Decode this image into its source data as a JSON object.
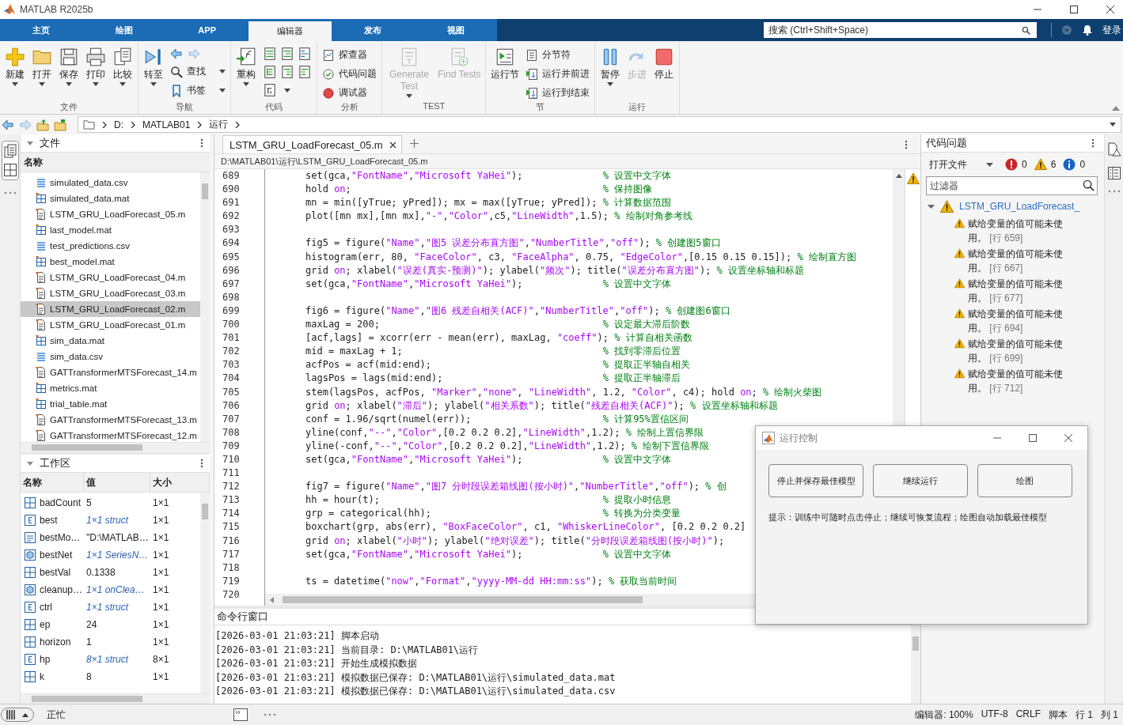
{
  "window": {
    "title": "MATLAB R2025b"
  },
  "tabs": [
    {
      "label": "主页",
      "selected": false
    },
    {
      "label": "绘图",
      "selected": false
    },
    {
      "label": "APP",
      "selected": false
    },
    {
      "label": "编辑器",
      "selected": true
    },
    {
      "label": "发布",
      "selected": false
    },
    {
      "label": "视图",
      "selected": false
    }
  ],
  "search": {
    "placeholder": "搜索 (Ctrl+Shift+Space)"
  },
  "sign_in": "登录",
  "toolstrip": {
    "groups": [
      {
        "label": "文件",
        "items": [
          {
            "kind": "large",
            "label": "新建",
            "dropdown": true,
            "disabled": false
          },
          {
            "kind": "large",
            "label": "打开",
            "dropdown": true,
            "disabled": false
          },
          {
            "kind": "large",
            "label": "保存",
            "dropdown": true,
            "disabled": false
          },
          {
            "kind": "large",
            "label": "打印",
            "dropdown": true,
            "disabled": false
          },
          {
            "kind": "large",
            "label": "比较",
            "dropdown": true,
            "disabled": false
          }
        ]
      },
      {
        "label": "导航",
        "items": [
          {
            "kind": "large",
            "label": "转至",
            "dropdown": true,
            "disabled": false
          },
          {
            "kind": "arrows"
          },
          {
            "kind": "small",
            "label": "查找",
            "dropdown": true,
            "disabled": false
          },
          {
            "kind": "small",
            "label": "书签",
            "dropdown": true,
            "disabled": false
          }
        ]
      },
      {
        "label": "代码",
        "items": [
          {
            "kind": "large",
            "label": "重构",
            "dropdown": true,
            "disabled": false
          },
          {
            "kind": "icon-grid"
          }
        ]
      },
      {
        "label": "分析",
        "items": [
          {
            "kind": "small",
            "label": "探查器",
            "dropdown": false,
            "disabled": false
          },
          {
            "kind": "small",
            "label": "代码问题",
            "dropdown": false,
            "disabled": false
          },
          {
            "kind": "small",
            "label": "调试器",
            "dropdown": false,
            "disabled": false
          }
        ]
      },
      {
        "label": "TEST",
        "items": [
          {
            "kind": "large",
            "label": "Generate Test",
            "dropdown": true,
            "disabled": true
          },
          {
            "kind": "large",
            "label": "Find Tests",
            "dropdown": false,
            "disabled": true
          }
        ]
      },
      {
        "label": "节",
        "items": [
          {
            "kind": "large",
            "label": "运行节",
            "dropdown": false,
            "disabled": false
          },
          {
            "kind": "small",
            "label": "分节符",
            "dropdown": false,
            "disabled": false
          },
          {
            "kind": "small",
            "label": "运行并前进",
            "dropdown": false,
            "disabled": false
          },
          {
            "kind": "small",
            "label": "运行到结束",
            "dropdown": false,
            "disabled": false
          }
        ]
      },
      {
        "label": "运行",
        "items": [
          {
            "kind": "large",
            "label": "暂停",
            "dropdown": true,
            "disabled": false
          },
          {
            "kind": "large",
            "label": "步进",
            "dropdown": false,
            "disabled": true
          },
          {
            "kind": "large",
            "label": "停止",
            "dropdown": false,
            "disabled": false
          }
        ]
      }
    ]
  },
  "address_bar": {
    "path": [
      "D:",
      "MATLAB01",
      "运行"
    ]
  },
  "files": {
    "title": "文件",
    "column": "名称",
    "items": [
      {
        "name": "simulated_data.csv",
        "kind": "csv",
        "selected": false
      },
      {
        "name": "simulated_data.mat",
        "kind": "mat",
        "selected": false
      },
      {
        "name": "LSTM_GRU_LoadForecast_05.m",
        "kind": "m",
        "selected": false
      },
      {
        "name": "last_model.mat",
        "kind": "mat",
        "selected": false
      },
      {
        "name": "test_predictions.csv",
        "kind": "csv",
        "selected": false
      },
      {
        "name": "best_model.mat",
        "kind": "mat",
        "selected": false
      },
      {
        "name": "LSTM_GRU_LoadForecast_04.m",
        "kind": "m",
        "selected": false
      },
      {
        "name": "LSTM_GRU_LoadForecast_03.m",
        "kind": "m",
        "selected": false
      },
      {
        "name": "LSTM_GRU_LoadForecast_02.m",
        "kind": "m",
        "selected": true
      },
      {
        "name": "LSTM_GRU_LoadForecast_01.m",
        "kind": "m",
        "selected": false
      },
      {
        "name": "sim_data.mat",
        "kind": "mat",
        "selected": false
      },
      {
        "name": "sim_data.csv",
        "kind": "csv",
        "selected": false
      },
      {
        "name": "GATTransformerMTSForecast_14.m",
        "kind": "m",
        "selected": false
      },
      {
        "name": "metrics.mat",
        "kind": "mat",
        "selected": false
      },
      {
        "name": "trial_table.mat",
        "kind": "mat",
        "selected": false
      },
      {
        "name": "GATTransformerMTSForecast_13.m",
        "kind": "m",
        "selected": false
      },
      {
        "name": "GATTransformerMTSForecast_12.m",
        "kind": "m",
        "selected": false
      }
    ]
  },
  "workspace": {
    "title": "工作区",
    "columns": [
      "名称",
      "值",
      "大小"
    ],
    "rows": [
      {
        "name": "badCount",
        "value": "5",
        "size": "1×1",
        "kind": "double"
      },
      {
        "name": "best",
        "value": "1×1 struct",
        "size": "1×1",
        "kind": "struct"
      },
      {
        "name": "bestMo…",
        "value": "\"D:\\MATLAB…",
        "size": "1×1",
        "kind": "char"
      },
      {
        "name": "bestNet",
        "value": "1×1 SeriesN…",
        "size": "1×1",
        "kind": "object"
      },
      {
        "name": "bestVal",
        "value": "0.1338",
        "size": "1×1",
        "kind": "double"
      },
      {
        "name": "cleanup…",
        "value": "1×1 onClea…",
        "size": "1×1",
        "kind": "object"
      },
      {
        "name": "ctrl",
        "value": "1×1 struct",
        "size": "1×1",
        "kind": "struct"
      },
      {
        "name": "ep",
        "value": "24",
        "size": "1×1",
        "kind": "double"
      },
      {
        "name": "horizon",
        "value": "1",
        "size": "1×1",
        "kind": "double"
      },
      {
        "name": "hp",
        "value": "8×1 struct",
        "size": "8×1",
        "kind": "struct"
      },
      {
        "name": "k",
        "value": "8",
        "size": "1×1",
        "kind": "double"
      }
    ]
  },
  "editor": {
    "tabs": [
      {
        "label": "LSTM_GRU_LoadForecast_05.m",
        "selected": true
      }
    ],
    "path": "D:\\MATLAB01\\运行\\LSTM_GRU_LoadForecast_05.m",
    "lines": [
      {
        "number": "689",
        "segments": [
          {
            "kind": "plain",
            "text": "set(gca,"
          },
          {
            "kind": "string",
            "text": "\"FontName\""
          },
          {
            "kind": "plain",
            "text": ","
          },
          {
            "kind": "string",
            "text": "\"Microsoft YaHei\""
          },
          {
            "kind": "plain",
            "text": ");              "
          },
          {
            "kind": "comment",
            "text": "% 设置中文字体"
          }
        ]
      },
      {
        "number": "690",
        "segments": [
          {
            "kind": "plain",
            "text": "hold "
          },
          {
            "kind": "string",
            "text": "on"
          },
          {
            "kind": "plain",
            "text": ";                                            "
          },
          {
            "kind": "comment",
            "text": "% 保持图像"
          }
        ]
      },
      {
        "number": "691",
        "segments": [
          {
            "kind": "plain",
            "text": "mn = min([yTrue; yPred]); mx = max([yTrue; yPred]); "
          },
          {
            "kind": "comment",
            "text": "% 计算数据范围"
          }
        ]
      },
      {
        "number": "692",
        "segments": [
          {
            "kind": "plain",
            "text": "plot([mn mx],[mn mx],"
          },
          {
            "kind": "string",
            "text": "\"-\""
          },
          {
            "kind": "plain",
            "text": ","
          },
          {
            "kind": "string",
            "text": "\"Color\""
          },
          {
            "kind": "plain",
            "text": ",c5,"
          },
          {
            "kind": "string",
            "text": "\"LineWidth\""
          },
          {
            "kind": "plain",
            "text": ",1.5); "
          },
          {
            "kind": "comment",
            "text": "% 绘制对角参考线"
          }
        ]
      },
      {
        "number": "693"
      },
      {
        "number": "694",
        "segments": [
          {
            "kind": "plain",
            "text": "fig5 = figure("
          },
          {
            "kind": "string",
            "text": "\"Name\""
          },
          {
            "kind": "plain",
            "text": ","
          },
          {
            "kind": "string",
            "text": "\"图5 误差分布直方图\""
          },
          {
            "kind": "plain",
            "text": ","
          },
          {
            "kind": "string",
            "text": "\"NumberTitle\""
          },
          {
            "kind": "plain",
            "text": ","
          },
          {
            "kind": "string",
            "text": "\"off\""
          },
          {
            "kind": "plain",
            "text": "); "
          },
          {
            "kind": "comment",
            "text": "% 创建图5窗口"
          }
        ]
      },
      {
        "number": "695",
        "segments": [
          {
            "kind": "plain",
            "text": "histogram(err, 80, "
          },
          {
            "kind": "string",
            "text": "\"FaceColor\""
          },
          {
            "kind": "plain",
            "text": ", c3, "
          },
          {
            "kind": "string",
            "text": "\"FaceAlpha\""
          },
          {
            "kind": "plain",
            "text": ", 0.75, "
          },
          {
            "kind": "string",
            "text": "\"EdgeColor\""
          },
          {
            "kind": "plain",
            "text": ",[0.15 0.15 0.15]); "
          },
          {
            "kind": "comment",
            "text": "% 绘制直方图"
          }
        ]
      },
      {
        "number": "696",
        "segments": [
          {
            "kind": "plain",
            "text": "grid "
          },
          {
            "kind": "string",
            "text": "on"
          },
          {
            "kind": "plain",
            "text": "; xlabel("
          },
          {
            "kind": "string",
            "text": "\"误差(真实-预测)\""
          },
          {
            "kind": "plain",
            "text": "); ylabel("
          },
          {
            "kind": "string",
            "text": "\"频次\""
          },
          {
            "kind": "plain",
            "text": "); title("
          },
          {
            "kind": "string",
            "text": "\"误差分布直方图\""
          },
          {
            "kind": "plain",
            "text": "); "
          },
          {
            "kind": "comment",
            "text": "% 设置坐标轴和标题"
          }
        ]
      },
      {
        "number": "697",
        "segments": [
          {
            "kind": "plain",
            "text": "set(gca,"
          },
          {
            "kind": "string",
            "text": "\"FontName\""
          },
          {
            "kind": "plain",
            "text": ","
          },
          {
            "kind": "string",
            "text": "\"Microsoft YaHei\""
          },
          {
            "kind": "plain",
            "text": ");              "
          },
          {
            "kind": "comment",
            "text": "% 设置中文字体"
          }
        ]
      },
      {
        "number": "698"
      },
      {
        "number": "699",
        "segments": [
          {
            "kind": "plain",
            "text": "fig6 = figure("
          },
          {
            "kind": "string",
            "text": "\"Name\""
          },
          {
            "kind": "plain",
            "text": ","
          },
          {
            "kind": "string",
            "text": "\"图6 残差自相关(ACF)\""
          },
          {
            "kind": "plain",
            "text": ","
          },
          {
            "kind": "string",
            "text": "\"NumberTitle\""
          },
          {
            "kind": "plain",
            "text": ","
          },
          {
            "kind": "string",
            "text": "\"off\""
          },
          {
            "kind": "plain",
            "text": "); "
          },
          {
            "kind": "comment",
            "text": "% 创建图6窗口"
          }
        ]
      },
      {
        "number": "700",
        "segments": [
          {
            "kind": "plain",
            "text": "maxLag = 200;                                       "
          },
          {
            "kind": "comment",
            "text": "% 设定最大滞后阶数"
          }
        ]
      },
      {
        "number": "701",
        "segments": [
          {
            "kind": "plain",
            "text": "[acf,lags] = xcorr(err - mean(err), maxLag, "
          },
          {
            "kind": "string",
            "text": "\"coeff\""
          },
          {
            "kind": "plain",
            "text": "); "
          },
          {
            "kind": "comment",
            "text": "% 计算自相关函数"
          }
        ]
      },
      {
        "number": "702",
        "segments": [
          {
            "kind": "plain",
            "text": "mid = maxLag + 1;                                   "
          },
          {
            "kind": "comment",
            "text": "% 找到零滞后位置"
          }
        ]
      },
      {
        "number": "703",
        "segments": [
          {
            "kind": "plain",
            "text": "acfPos = acf(mid:end);                              "
          },
          {
            "kind": "comment",
            "text": "% 提取正半轴自相关"
          }
        ]
      },
      {
        "number": "704",
        "segments": [
          {
            "kind": "plain",
            "text": "lagsPos = lags(mid:end);                            "
          },
          {
            "kind": "comment",
            "text": "% 提取正半轴滞后"
          }
        ]
      },
      {
        "number": "705",
        "segments": [
          {
            "kind": "plain",
            "text": "stem(lagsPos, acfPos, "
          },
          {
            "kind": "string",
            "text": "\"Marker\""
          },
          {
            "kind": "plain",
            "text": ","
          },
          {
            "kind": "string",
            "text": "\"none\""
          },
          {
            "kind": "plain",
            "text": ", "
          },
          {
            "kind": "string",
            "text": "\"LineWidth\""
          },
          {
            "kind": "plain",
            "text": ", 1.2, "
          },
          {
            "kind": "string",
            "text": "\"Color\""
          },
          {
            "kind": "plain",
            "text": ", c4); hold "
          },
          {
            "kind": "string",
            "text": "on"
          },
          {
            "kind": "plain",
            "text": "; "
          },
          {
            "kind": "comment",
            "text": "% 绘制火柴图"
          }
        ]
      },
      {
        "number": "706",
        "segments": [
          {
            "kind": "plain",
            "text": "grid "
          },
          {
            "kind": "string",
            "text": "on"
          },
          {
            "kind": "plain",
            "text": "; xlabel("
          },
          {
            "kind": "string",
            "text": "\"滞后\""
          },
          {
            "kind": "plain",
            "text": "); ylabel("
          },
          {
            "kind": "string",
            "text": "\"相关系数\""
          },
          {
            "kind": "plain",
            "text": "); title("
          },
          {
            "kind": "string",
            "text": "\"残差自相关(ACF)\""
          },
          {
            "kind": "plain",
            "text": "); "
          },
          {
            "kind": "comment",
            "text": "% 设置坐标轴和标题"
          }
        ]
      },
      {
        "number": "707",
        "segments": [
          {
            "kind": "plain",
            "text": "conf = 1.96/sqrt(numel(err));                       "
          },
          {
            "kind": "comment",
            "text": "% 计算95%置信区间"
          }
        ]
      },
      {
        "number": "708",
        "segments": [
          {
            "kind": "plain",
            "text": "yline(conf,"
          },
          {
            "kind": "string",
            "text": "\"--\""
          },
          {
            "kind": "plain",
            "text": ","
          },
          {
            "kind": "string",
            "text": "\"Color\""
          },
          {
            "kind": "plain",
            "text": ",[0.2 0.2 0.2],"
          },
          {
            "kind": "string",
            "text": "\"LineWidth\""
          },
          {
            "kind": "plain",
            "text": ",1.2); "
          },
          {
            "kind": "comment",
            "text": "% 绘制上置信界限"
          }
        ]
      },
      {
        "number": "709",
        "segments": [
          {
            "kind": "plain",
            "text": "yline(-conf,"
          },
          {
            "kind": "string",
            "text": "\"--\""
          },
          {
            "kind": "plain",
            "text": ","
          },
          {
            "kind": "string",
            "text": "\"Color\""
          },
          {
            "kind": "plain",
            "text": ",[0.2 0.2 0.2],"
          },
          {
            "kind": "string",
            "text": "\"LineWidth\""
          },
          {
            "kind": "plain",
            "text": ",1.2); "
          },
          {
            "kind": "comment",
            "text": "% 绘制下置信界限"
          }
        ]
      },
      {
        "number": "710",
        "segments": [
          {
            "kind": "plain",
            "text": "set(gca,"
          },
          {
            "kind": "string",
            "text": "\"FontName\""
          },
          {
            "kind": "plain",
            "text": ","
          },
          {
            "kind": "string",
            "text": "\"Microsoft YaHei\""
          },
          {
            "kind": "plain",
            "text": ");              "
          },
          {
            "kind": "comment",
            "text": "% 设置中文字体"
          }
        ]
      },
      {
        "number": "711"
      },
      {
        "number": "712",
        "segments": [
          {
            "kind": "plain",
            "text": "fig7 = figure("
          },
          {
            "kind": "string",
            "text": "\"Name\""
          },
          {
            "kind": "plain",
            "text": ","
          },
          {
            "kind": "string",
            "text": "\"图7 分时段误差箱线图(按小时)\""
          },
          {
            "kind": "plain",
            "text": ","
          },
          {
            "kind": "string",
            "text": "\"NumberTitle\""
          },
          {
            "kind": "plain",
            "text": ","
          },
          {
            "kind": "string",
            "text": "\"off\""
          },
          {
            "kind": "plain",
            "text": "); "
          },
          {
            "kind": "comment",
            "text": "% 创"
          }
        ]
      },
      {
        "number": "713",
        "segments": [
          {
            "kind": "plain",
            "text": "hh = hour(t);                                       "
          },
          {
            "kind": "comment",
            "text": "% 提取小时信息"
          }
        ]
      },
      {
        "number": "714",
        "segments": [
          {
            "kind": "plain",
            "text": "grp = categorical(hh);                              "
          },
          {
            "kind": "comment",
            "text": "% 转换为分类变量"
          }
        ]
      },
      {
        "number": "715",
        "segments": [
          {
            "kind": "plain",
            "text": "boxchart(grp, abs(err), "
          },
          {
            "kind": "string",
            "text": "\"BoxFaceColor\""
          },
          {
            "kind": "plain",
            "text": ", c1, "
          },
          {
            "kind": "string",
            "text": "\"WhiskerLineColor\""
          },
          {
            "kind": "plain",
            "text": ", [0.2 0.2 0.2]"
          }
        ]
      },
      {
        "number": "716",
        "segments": [
          {
            "kind": "plain",
            "text": "grid "
          },
          {
            "kind": "string",
            "text": "on"
          },
          {
            "kind": "plain",
            "text": "; xlabel("
          },
          {
            "kind": "string",
            "text": "\"小时\""
          },
          {
            "kind": "plain",
            "text": "); ylabel("
          },
          {
            "kind": "string",
            "text": "\"绝对误差\""
          },
          {
            "kind": "plain",
            "text": "); title("
          },
          {
            "kind": "string",
            "text": "\"分时段误差箱线图(按小时)\""
          },
          {
            "kind": "plain",
            "text": ");"
          }
        ]
      },
      {
        "number": "717",
        "segments": [
          {
            "kind": "plain",
            "text": "set(gca,"
          },
          {
            "kind": "string",
            "text": "\"FontName\""
          },
          {
            "kind": "plain",
            "text": ","
          },
          {
            "kind": "string",
            "text": "\"Microsoft YaHei\""
          },
          {
            "kind": "plain",
            "text": ");              "
          },
          {
            "kind": "comment",
            "text": "% 设置中文字体"
          }
        ]
      },
      {
        "number": "718"
      },
      {
        "number": "719",
        "segments": [
          {
            "kind": "plain",
            "text": "ts = datetime("
          },
          {
            "kind": "string",
            "text": "\"now\""
          },
          {
            "kind": "plain",
            "text": ","
          },
          {
            "kind": "string",
            "text": "\"Format\""
          },
          {
            "kind": "plain",
            "text": ","
          },
          {
            "kind": "string",
            "text": "\"yyyy-MM-dd HH:mm:ss\""
          },
          {
            "kind": "plain",
            "text": "); "
          },
          {
            "kind": "comment",
            "text": "% 获取当前时间"
          }
        ]
      },
      {
        "number": "720"
      }
    ]
  },
  "command_window": {
    "title": "命令行窗口",
    "lines": [
      "[2026-03-01 21:03:21] 脚本启动",
      "[2026-03-01 21:03:21] 当前目录: D:\\MATLAB01\\运行",
      "[2026-03-01 21:03:21] 开始生成模拟数据",
      "[2026-03-01 21:03:21] 模拟数据已保存: D:\\MATLAB01\\运行\\simulated_data.mat",
      "[2026-03-01 21:03:21] 模拟数据已保存: D:\\MATLAB01\\运行\\simulated_data.csv"
    ]
  },
  "code_issues": {
    "title": "代码问题",
    "scope": "打开文件",
    "errors": "0",
    "warnings": "6",
    "infos": "0",
    "filter": {
      "placeholder": "过滤器"
    },
    "file": {
      "name": "LSTM_GRU_LoadForecast_",
      "expanded": true,
      "issues": [
        {
          "message": "赋给变量的值可能未使用。",
          "line": "[行 659]"
        },
        {
          "message": "赋给变量的值可能未使用。",
          "line": "[行 667]"
        },
        {
          "message": "赋给变量的值可能未使用。",
          "line": "[行 677]"
        },
        {
          "message": "赋给变量的值可能未使用。",
          "line": "[行 694]"
        },
        {
          "message": "赋给变量的值可能未使用。",
          "line": "[行 699]"
        },
        {
          "message": "赋给变量的值可能未使用。",
          "line": "[行 712]"
        }
      ]
    }
  },
  "dialog": {
    "title": "运行控制",
    "buttons": [
      "停止并保存最佳模型",
      "继续运行",
      "绘图"
    ],
    "hint": "提示：训练中可随时点击停止；继续可恢复流程；绘图自动加载最佳模型"
  },
  "status_bar": {
    "state": "正忙",
    "items": [
      "编辑器: 100%",
      "UTF-8",
      "CRLF",
      "脚本",
      "行 1",
      "列 1"
    ]
  }
}
